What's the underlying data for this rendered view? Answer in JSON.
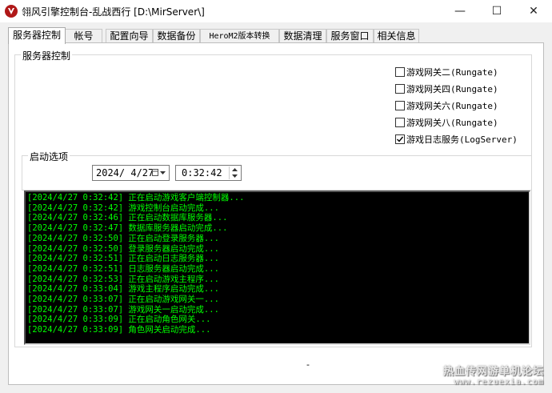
{
  "window": {
    "title": "翎风引擎控制台-乱战西行 [D:\\MirServer\\]",
    "minimize_glyph": "—",
    "maximize_glyph": "☐",
    "close_glyph": "✕"
  },
  "tabs": [
    {
      "label": "服务器控制",
      "active": true
    },
    {
      "label": "帐号",
      "active": false
    },
    {
      "label": "配置向导",
      "active": false
    },
    {
      "label": "数据备份",
      "active": false
    },
    {
      "label": "HeroM2版本转换",
      "active": false
    },
    {
      "label": "数据清理",
      "active": false
    },
    {
      "label": "服务窗口",
      "active": false
    },
    {
      "label": "相关信息",
      "active": false
    }
  ],
  "server_control": {
    "legend": "服务器控制",
    "checkboxes": [
      {
        "label": "游戏网关二(Rungate)",
        "checked": false
      },
      {
        "label": "游戏网关四(Rungate)",
        "checked": false
      },
      {
        "label": "游戏网关六(Rungate)",
        "checked": false
      },
      {
        "label": "游戏网关八(Rungate)",
        "checked": false
      },
      {
        "label": "游戏日志服务(LogServer)",
        "checked": true
      }
    ]
  },
  "startup": {
    "legend": "启动选项",
    "date": "2024/ 4/27",
    "time": "0:32:42"
  },
  "log": [
    "[2024/4/27 0:32:42] 正在启动游戏客户端控制器...",
    "[2024/4/27 0:32:42] 游戏控制台启动完成...",
    "[2024/4/27 0:32:46] 正在启动数据库服务器...",
    "[2024/4/27 0:32:47] 数据库服务器启动完成...",
    "[2024/4/27 0:32:50] 正在启动登录服务器...",
    "[2024/4/27 0:32:50] 登录服务器启动完成...",
    "[2024/4/27 0:32:51] 正在启动日志服务器...",
    "[2024/4/27 0:32:51] 日志服务器启动完成...",
    "[2024/4/27 0:32:53] 正在启动游戏主程序...",
    "[2024/4/27 0:33:04] 游戏主程序启动完成...",
    "[2024/4/27 0:33:07] 正在启动游戏网关一...",
    "[2024/4/27 0:33:07] 游戏网关一启动完成...",
    "[2024/4/27 0:33:09] 正在启动角色网关...",
    "[2024/4/27 0:33:09] 角色网关启动完成..."
  ],
  "status_dash": "-",
  "watermark": {
    "line1": "热血传网游单机论坛",
    "line2": "www.rezuexia.com"
  },
  "colors": {
    "log_text": "#00ff00",
    "log_background": "#000000",
    "app_icon": "#b01818"
  }
}
